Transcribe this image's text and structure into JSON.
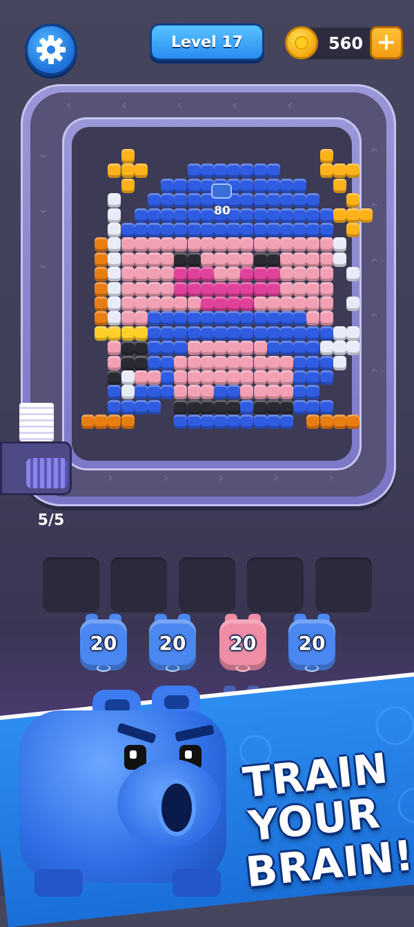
{
  "header": {
    "settings_icon": "gear-icon",
    "level_label": "Level 17",
    "coins": "560",
    "add_coins_label": "+"
  },
  "board": {
    "block_tag_value": "80",
    "queue_count": "5/5",
    "colors": {
      "blue": "#2f5ce0",
      "pink": "#f2a0b4",
      "magenta": "#e0429a",
      "white": "#e8ecf8",
      "black": "#2a2a33",
      "yellow": "#ffcf2a",
      "orange": "#e87d12",
      "gold": "#ffb21a"
    }
  },
  "slots": {
    "count": 5
  },
  "pieces": [
    {
      "color": "blue",
      "value": "20"
    },
    {
      "color": "blue",
      "value": "20"
    },
    {
      "color": "pink",
      "value": "20"
    },
    {
      "color": "blue",
      "value": "20"
    }
  ],
  "promo": {
    "line1": "TRAIN",
    "line2": "YOUR",
    "line3": "BRAIN!"
  }
}
